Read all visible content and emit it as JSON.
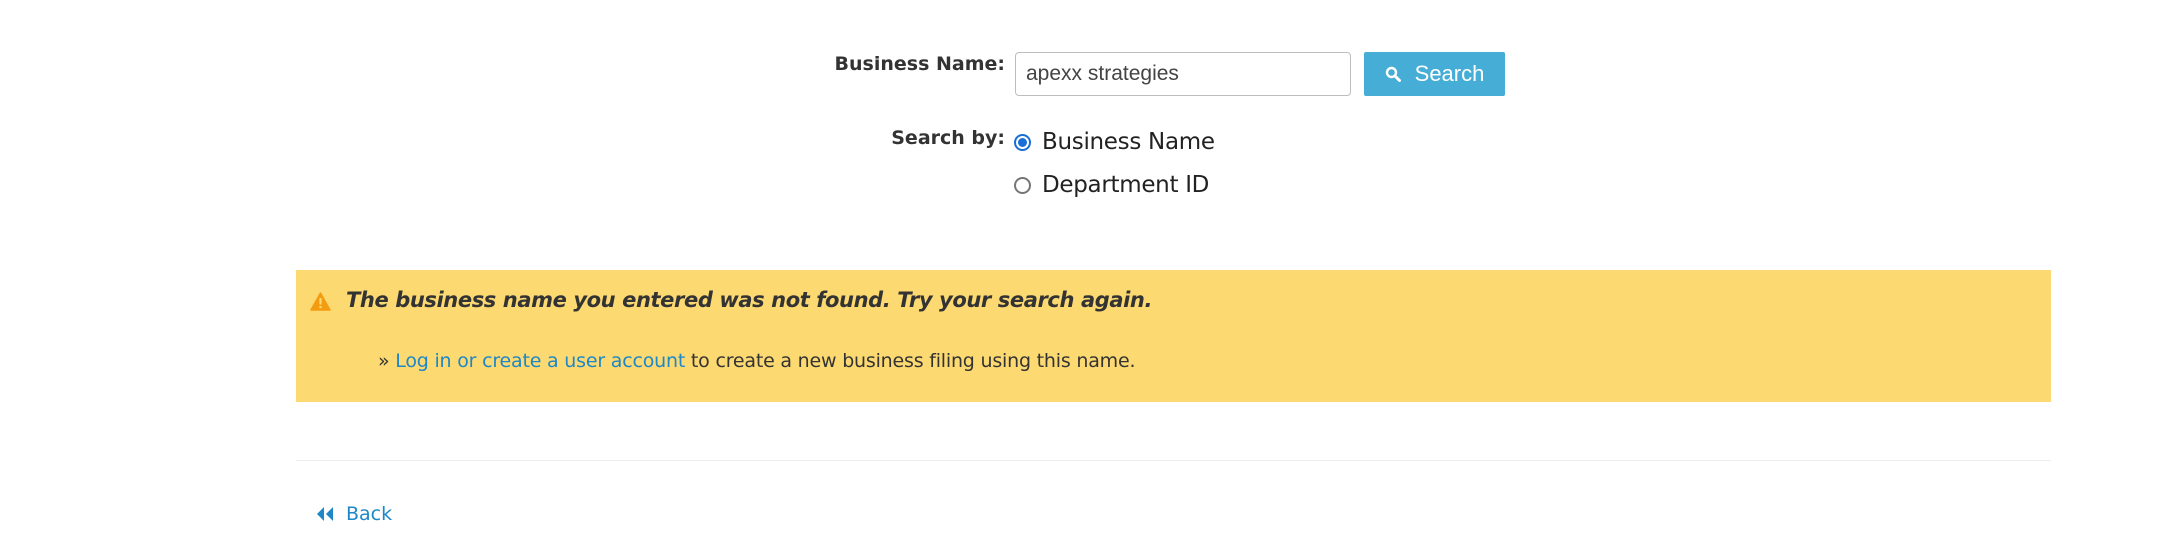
{
  "form": {
    "business_name_label": "Business Name:",
    "business_name_value": "apexx strategies",
    "search_button_label": "Search",
    "search_by_label": "Search by:",
    "options": [
      {
        "label": "Business Name",
        "checked": true
      },
      {
        "label": "Department ID",
        "checked": false
      }
    ]
  },
  "alert": {
    "message": "The business name you entered was not found. Try your search again.",
    "prefix": "» ",
    "link_text": "Log in or create a user account",
    "suffix": " to create a new business filing using this name."
  },
  "nav": {
    "back_label": "Back"
  },
  "colors": {
    "alert_background": "#fcd971",
    "button_background": "#46aed6",
    "link": "#1d87c7",
    "radio_selected": "#1a6fd6",
    "warning_icon": "#f39c12"
  },
  "icons": {
    "search_button_icon": "search-icon",
    "alert_icon": "warning-icon",
    "back_icon": "double-chevron-left-icon"
  }
}
